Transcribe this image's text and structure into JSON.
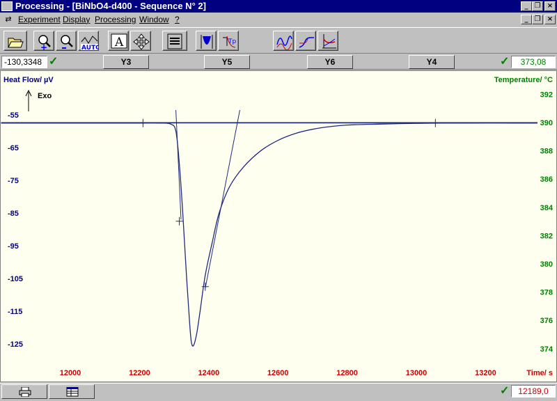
{
  "window": {
    "title": "Processing - [BiNbO4-d400 - Sequence N° 2]",
    "controls": [
      "_",
      "❐",
      "×"
    ]
  },
  "menubar": {
    "items": [
      "Experiment",
      "Display",
      "Processing",
      "Window",
      "?"
    ]
  },
  "toolbar": {
    "buttons": [
      {
        "name": "open-file",
        "icon": "folder-icon"
      },
      {
        "name": "zoom-in",
        "icon": "zoom-in-icon"
      },
      {
        "name": "zoom-out",
        "icon": "zoom-out-icon"
      },
      {
        "name": "auto-scale",
        "icon": "auto-scale-icon",
        "label": "AUTO"
      },
      {
        "name": "text-annotation",
        "icon": "text-a-icon",
        "label": "A"
      },
      {
        "name": "pan",
        "icon": "move-arrows-icon"
      },
      {
        "name": "layout",
        "icon": "layout-icon"
      },
      {
        "name": "peak-area",
        "icon": "peak-area-icon"
      },
      {
        "name": "onset",
        "icon": "onset-icon"
      },
      {
        "name": "curve-1",
        "icon": "curve-icon"
      },
      {
        "name": "curve-2",
        "icon": "curve-icon"
      },
      {
        "name": "curve-3",
        "icon": "curve-icon"
      }
    ]
  },
  "axisbar": {
    "left_value": "-130,3348",
    "right_value": "373,08",
    "y_buttons": [
      "Y3",
      "Y5",
      "Y6",
      "Y4"
    ]
  },
  "status": {
    "time_value": "12189,0"
  },
  "colors": {
    "title_bg": "#000080",
    "plot_bg": "#fffff0",
    "curve": "#1f2a7a",
    "left_axis": "#000080",
    "right_axis": "#008000",
    "x_axis": "#cc0000"
  },
  "chart_data": {
    "type": "line",
    "ylabel": "Heat Flow/ µV",
    "annotation": "Exo",
    "ylabel_right": "Temperature/ °C",
    "xlabel": "Time/ s",
    "x_ticks": [
      "12000",
      "12200",
      "12400",
      "12600",
      "12800",
      "13000",
      "13200"
    ],
    "y_ticks": [
      "-55",
      "-65",
      "-75",
      "-85",
      "-95",
      "-105",
      "-115",
      "-125"
    ],
    "y_right_ticks": [
      "392",
      "390",
      "388",
      "386",
      "384",
      "382",
      "380",
      "378",
      "376",
      "374"
    ],
    "xlim": [
      11800,
      13350
    ],
    "ylim": [
      -130,
      -48
    ],
    "y_right_lim": [
      373,
      393
    ],
    "series": [
      {
        "kind": "heat-flow",
        "points": [
          [
            11800,
            -57.5
          ],
          [
            12100,
            -57.5
          ],
          [
            12200,
            -57.5
          ],
          [
            12260,
            -57.5
          ],
          [
            12290,
            -57.8
          ],
          [
            12305,
            -60
          ],
          [
            12315,
            -70
          ],
          [
            12325,
            -85
          ],
          [
            12335,
            -103
          ],
          [
            12345,
            -119
          ],
          [
            12350,
            -124.5
          ],
          [
            12356,
            -125.5
          ],
          [
            12365,
            -122
          ],
          [
            12375,
            -115
          ],
          [
            12390,
            -104
          ],
          [
            12410,
            -94
          ],
          [
            12430,
            -85
          ],
          [
            12460,
            -77
          ],
          [
            12500,
            -71
          ],
          [
            12550,
            -66
          ],
          [
            12600,
            -62.8
          ],
          [
            12650,
            -60.7
          ],
          [
            12700,
            -59.4
          ],
          [
            12750,
            -58.6
          ],
          [
            12800,
            -58.1
          ],
          [
            12900,
            -57.8
          ],
          [
            13000,
            -57.6
          ],
          [
            13100,
            -57.5
          ],
          [
            13350,
            -57.5
          ]
        ]
      },
      {
        "kind": "baseline",
        "points": [
          [
            11800,
            -57.5
          ],
          [
            13350,
            -57.5
          ]
        ]
      },
      {
        "kind": "onset-tangent",
        "points": [
          [
            12305,
            -53.5
          ],
          [
            12320,
            -87
          ]
        ]
      },
      {
        "kind": "endset-tangent",
        "points": [
          [
            12390,
            -108
          ],
          [
            12490,
            -53.5
          ]
        ]
      },
      {
        "kind": "temperature",
        "points": [
          [
            11800,
            390
          ],
          [
            13350,
            390
          ]
        ]
      }
    ],
    "markers": [
      {
        "x": 12210,
        "y": -57.5
      },
      {
        "x": 12315,
        "y": -87.5
      },
      {
        "x": 12390,
        "y": -107.5
      },
      {
        "x": 13055,
        "y": -57.5
      }
    ],
    "grid": false
  }
}
